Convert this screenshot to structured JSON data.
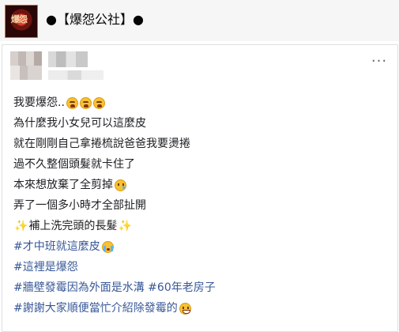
{
  "header": {
    "logo_text": "爆怨",
    "title": "●【爆怨公社】●"
  },
  "post": {
    "more_label": "···",
    "lines": {
      "l1": "我要爆怨..",
      "l2": "為什麼我小女兒可以這麼皮",
      "l3": "就在剛剛自己拿捲梳說爸爸我要燙捲",
      "l4": "過不久整個頭髮就卡住了",
      "l5": "本來想放棄了全剪掉",
      "l6": "弄了一個多小時才全部扯開",
      "l7": "補上洗完頭的長髮",
      "l8": "#才中班就這麼皮",
      "l9": "#這裡是爆怨",
      "l10": "#牆壁發霉因為外面是水溝 #60年老房子",
      "l11": "#謝謝大家順便當忙介紹除發霉的"
    },
    "sparkle_glyph": "✨",
    "icons": {
      "weary": "weary-face-icon",
      "sad": "sad-relieved-face-icon",
      "cry": "loudly-crying-face-icon",
      "grin": "grinning-face-icon",
      "sparkles": "sparkles-icon"
    },
    "colors": {
      "hashtag": "#385898",
      "text": "#1c1e21"
    }
  }
}
